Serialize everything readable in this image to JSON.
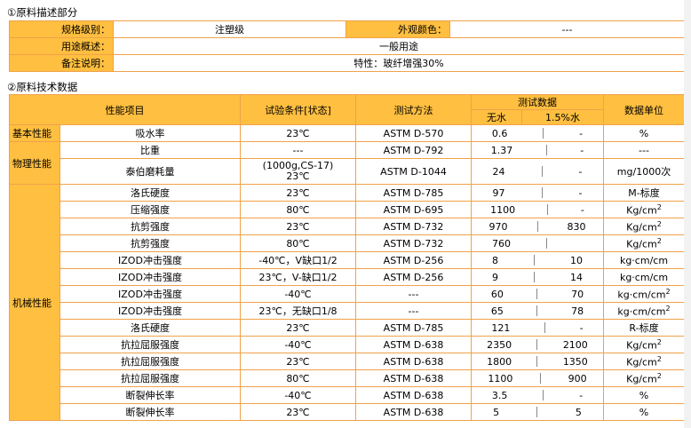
{
  "section1_title": "①原料描述部分",
  "desc": {
    "grade_label": "规格级别：",
    "grade_value": "注塑级",
    "color_label": "外观颜色：",
    "color_value": "---",
    "usage_label": "用途概述：",
    "usage_value": "一般用途",
    "remark_label": "备注说明：",
    "remark_value": "特性：玻纤增强30%"
  },
  "section2_title": "②原料技术数据",
  "header": {
    "item": "性能项目",
    "condition": "试验条件[状态]",
    "method": "测试方法",
    "data": "测试数据",
    "dry": "无水",
    "wet": "1.5%水",
    "unit": "数据单位"
  },
  "categories": {
    "basic": "基本性能",
    "physical": "物理性能",
    "mechanical": "机械性能"
  },
  "rows": [
    {
      "item": "吸水率",
      "cond": "23℃",
      "method": "ASTM D-570",
      "v1": "0.6",
      "v2": "-",
      "unit": "%"
    },
    {
      "item": "比重",
      "cond": "---",
      "method": "ASTM D-792",
      "v1": "1.37",
      "v2": "-",
      "unit": "---"
    },
    {
      "item": "泰伯磨耗量",
      "cond": "(1000g,CS-17)\n23℃",
      "method": "ASTM D-1044",
      "v1": "24",
      "v2": "-",
      "unit": "mg/1000次"
    },
    {
      "item": "洛氏硬度",
      "cond": "23℃",
      "method": "ASTM D-785",
      "v1": "97",
      "v2": "-",
      "unit": "M-标度"
    },
    {
      "item": "压缩强度",
      "cond": "80℃",
      "method": "ASTM D-695",
      "v1": "1100",
      "v2": "-",
      "unit": "Kg/cm2"
    },
    {
      "item": "抗剪强度",
      "cond": "23℃",
      "method": "ASTM D-732",
      "v1": "970",
      "v2": "830",
      "unit": "Kg/cm2"
    },
    {
      "item": "抗剪强度",
      "cond": "80℃",
      "method": "ASTM D-732",
      "v1": "760",
      "v2": "",
      "unit": "Kg/cm2"
    },
    {
      "item": "IZOD冲击强度",
      "cond": "-40℃，V缺口1/2",
      "method": "ASTM D-256",
      "v1": "8",
      "v2": "10",
      "unit": "kg·cm/cm"
    },
    {
      "item": "IZOD冲击强度",
      "cond": "23℃，V-缺口1/2",
      "method": "ASTM D-256",
      "v1": "9",
      "v2": "14",
      "unit": "kg·cm/cm"
    },
    {
      "item": "IZOD冲击强度",
      "cond": "-40℃",
      "method": "---",
      "v1": "60",
      "v2": "70",
      "unit": "kg·cm/cm2"
    },
    {
      "item": "IZOD冲击强度",
      "cond": "23℃，无缺口1/8",
      "method": "---",
      "v1": "65",
      "v2": "78",
      "unit": "kg·cm/cm2"
    },
    {
      "item": "洛氏硬度",
      "cond": "23℃",
      "method": "ASTM D-785",
      "v1": "121",
      "v2": "-",
      "unit": "R-标度"
    },
    {
      "item": "抗拉屈服强度",
      "cond": "-40℃",
      "method": "ASTM D-638",
      "v1": "2350",
      "v2": "2100",
      "unit": "Kg/cm2"
    },
    {
      "item": "抗拉屈服强度",
      "cond": "23℃",
      "method": "ASTM D-638",
      "v1": "1800",
      "v2": "1350",
      "unit": "Kg/cm2"
    },
    {
      "item": "抗拉屈服强度",
      "cond": "80℃",
      "method": "ASTM D-638",
      "v1": "1100",
      "v2": "900",
      "unit": "Kg/cm2"
    },
    {
      "item": "断裂伸长率",
      "cond": "-40℃",
      "method": "ASTM D-638",
      "v1": "3.5",
      "v2": "-",
      "unit": "%"
    },
    {
      "item": "断裂伸长率",
      "cond": "23℃",
      "method": "ASTM D-638",
      "v1": "5",
      "v2": "5",
      "unit": "%"
    }
  ]
}
